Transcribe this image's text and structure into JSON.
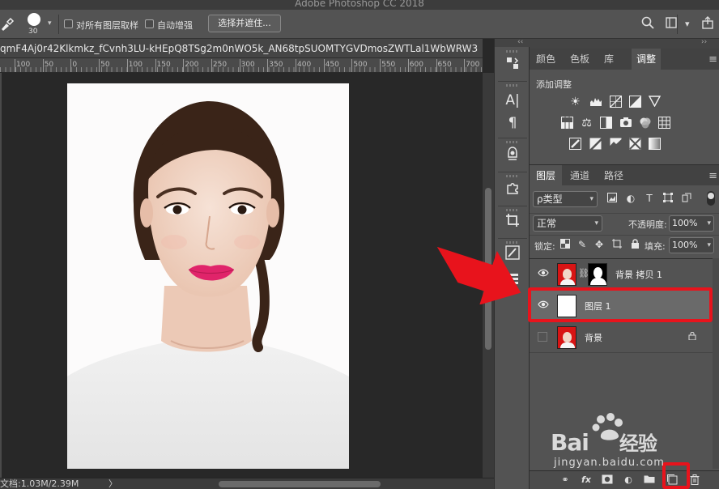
{
  "app": {
    "title": "Adobe Photoshop CC 2018"
  },
  "options_bar": {
    "brush_size": "30",
    "sample_all_layers_label": "对所有图层取样",
    "auto_enhance_label": "自动增强",
    "select_and_mask_label": "选择并遮住..."
  },
  "document": {
    "tab_title": "qmF4Aj0r42Klkmkz_fCvnh3LU-kHEpQ8TSg2m0nWO5k_AN68tpSUOMTYGVDmosZWTLal1WbWRW3"
  },
  "ruler": {
    "labels": [
      "100",
      "50",
      "0",
      "50",
      "100",
      "150",
      "200",
      "250",
      "300",
      "350",
      "400",
      "450",
      "500",
      "550",
      "600",
      "650",
      "700"
    ]
  },
  "status": {
    "doc_size": "文档:1.03M/2.39M",
    "arrow": "〉"
  },
  "adjustments_panel": {
    "tabs": [
      {
        "label": "颜色"
      },
      {
        "label": "色板"
      },
      {
        "label": "库"
      },
      {
        "label": "调整"
      }
    ],
    "active_tab": "调整",
    "title": "添加调整"
  },
  "layers_panel": {
    "tabs": [
      {
        "label": "图层"
      },
      {
        "label": "通道"
      },
      {
        "label": "路径"
      }
    ],
    "active_tab": "图层",
    "filter_kind": "ρ类型",
    "blend_mode": "正常",
    "opacity_label": "不透明度:",
    "opacity_value": "100%",
    "lock_label": "锁定:",
    "fill_label": "填充:",
    "fill_value": "100%",
    "layers": [
      {
        "name": "背景 拷贝 1",
        "visible": true,
        "selected": false,
        "has_mask": true
      },
      {
        "name": "图层 1",
        "visible": true,
        "selected": true,
        "has_mask": false
      },
      {
        "name": "背景",
        "visible": false,
        "selected": false,
        "locked": true
      }
    ],
    "footer_fx": "fx"
  },
  "watermark": {
    "brand": "Bai",
    "brand_suffix": "经验",
    "url": "jingyan.baidu.com"
  },
  "colors": {
    "highlight": "#e8131c",
    "panel_bg": "#535353",
    "canvas_bg": "#282828",
    "thumb_red": "#d81414"
  }
}
